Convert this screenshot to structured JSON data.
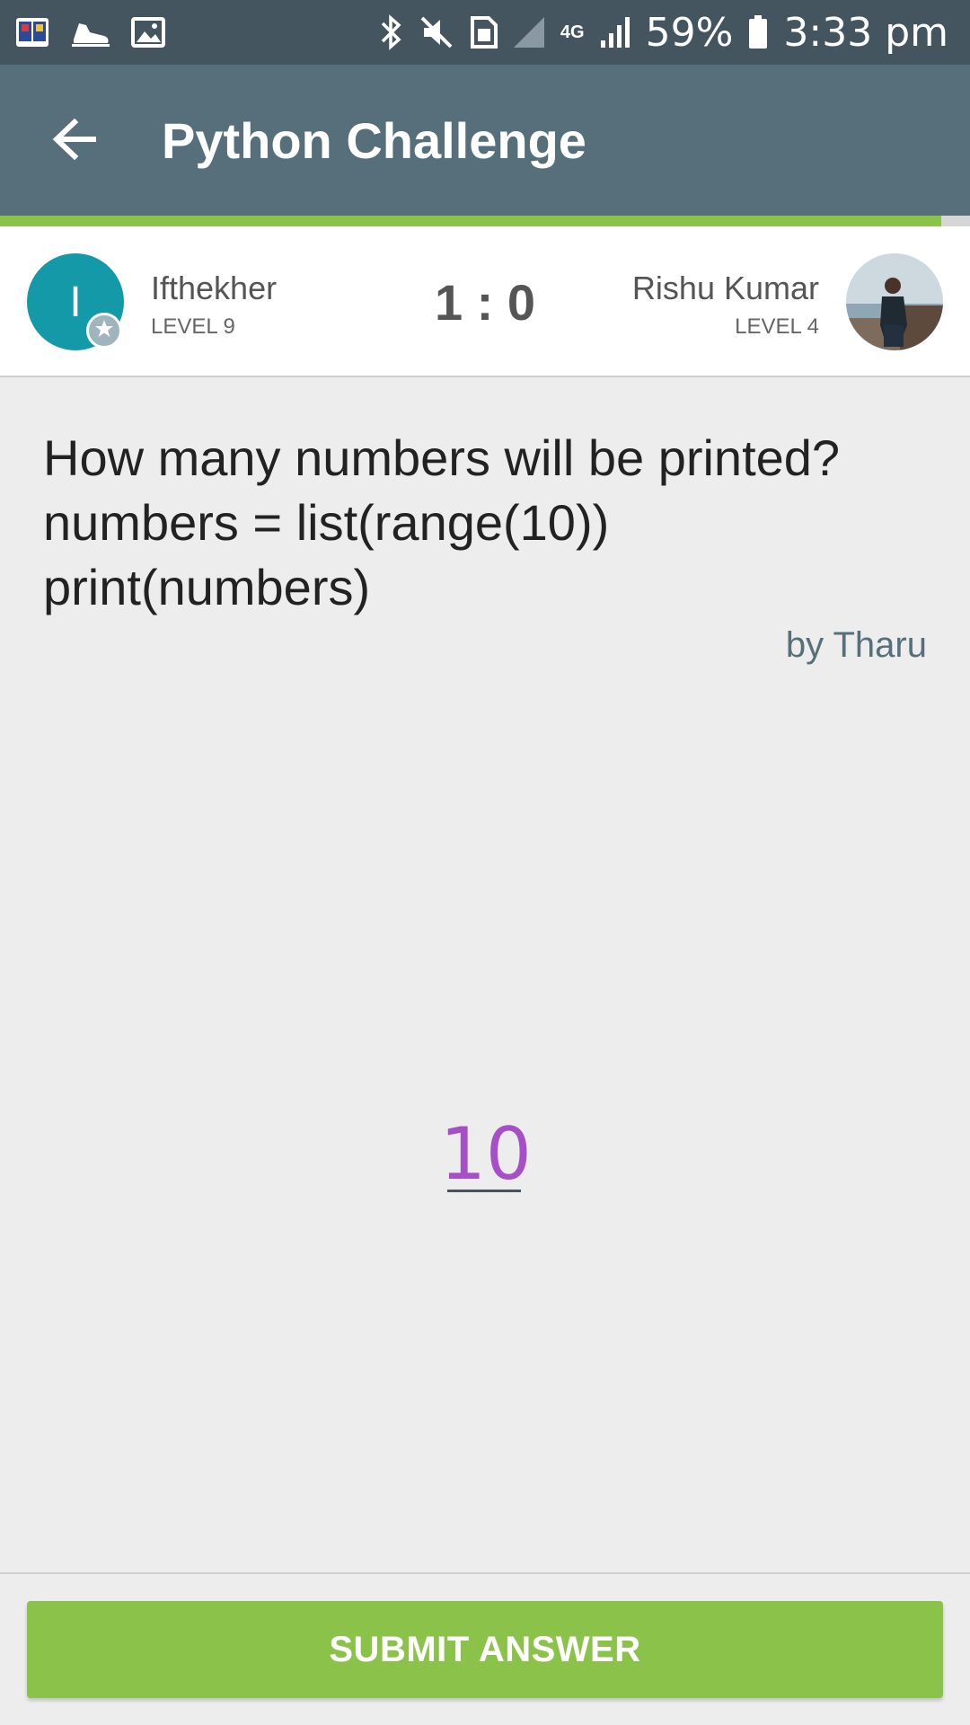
{
  "status_bar": {
    "battery_percent": "59%",
    "time": "3:33 pm",
    "network_label": "4G",
    "left_icons": [
      "app-book-icon",
      "shoe-icon",
      "image-icon"
    ],
    "right_icons": [
      "bluetooth-icon",
      "mute-icon",
      "sim-card-icon",
      "signal-icon",
      "4g-icon",
      "signal-icon",
      "battery-icon"
    ]
  },
  "app_bar": {
    "title": "Python Challenge",
    "back_icon": "arrow-left-icon"
  },
  "progress": {
    "fraction": 0.97,
    "color": "#8bc34a"
  },
  "players": {
    "left": {
      "initial": "I",
      "name": "Ifthekher",
      "level": "LEVEL 9",
      "badge_icon": "star-icon"
    },
    "right": {
      "name": "Rishu Kumar",
      "level": "LEVEL 4",
      "avatar": "profile-photo"
    },
    "score": "1 : 0"
  },
  "question": {
    "lines": [
      "How many numbers will be printed?",
      "numbers = list(range(10))",
      "print(numbers)"
    ],
    "author": "by Tharu"
  },
  "answer": {
    "value": "10"
  },
  "submit": {
    "label": "SUBMIT ANSWER"
  },
  "colors": {
    "status_bar": "#44555f",
    "app_bar": "#566f7a",
    "accent_green": "#8bc34a",
    "avatar_teal": "#1499a8",
    "answer_purple": "#a74fc6"
  }
}
